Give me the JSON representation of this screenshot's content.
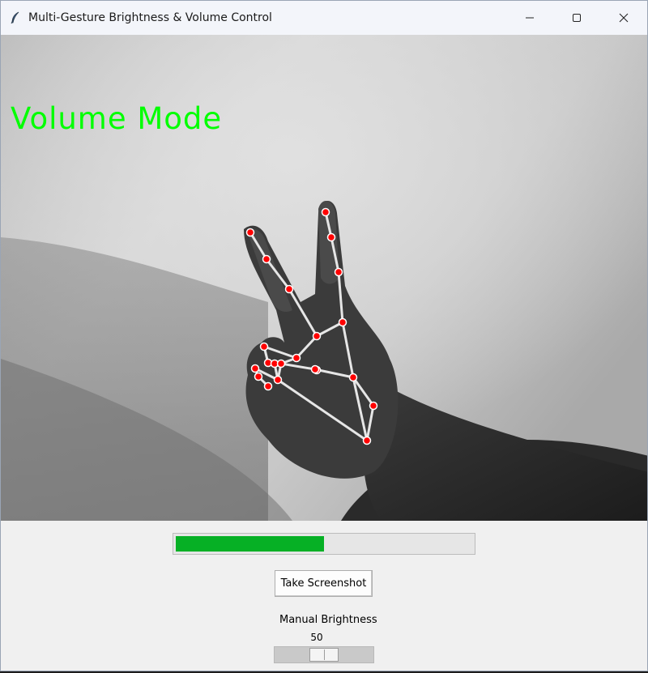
{
  "window": {
    "title": "Multi-Gesture Brightness & Volume Control",
    "icon": "feather-icon"
  },
  "title_controls": [
    "minimize-icon",
    "maximize-icon",
    "close-icon"
  ],
  "camera": {
    "mode_label": "Volume Mode",
    "overlay_color": "#00ff00",
    "landmark_color": "#ff0000",
    "connection_color": "#e6e6e6"
  },
  "volume_bar": {
    "level_fraction": 0.5,
    "fill_color": "#06b025"
  },
  "screenshot_button": {
    "label": "Take Screenshot"
  },
  "brightness_scale": {
    "label": "Manual Brightness",
    "value": "50",
    "min": 0,
    "max": 100,
    "position": 50
  }
}
